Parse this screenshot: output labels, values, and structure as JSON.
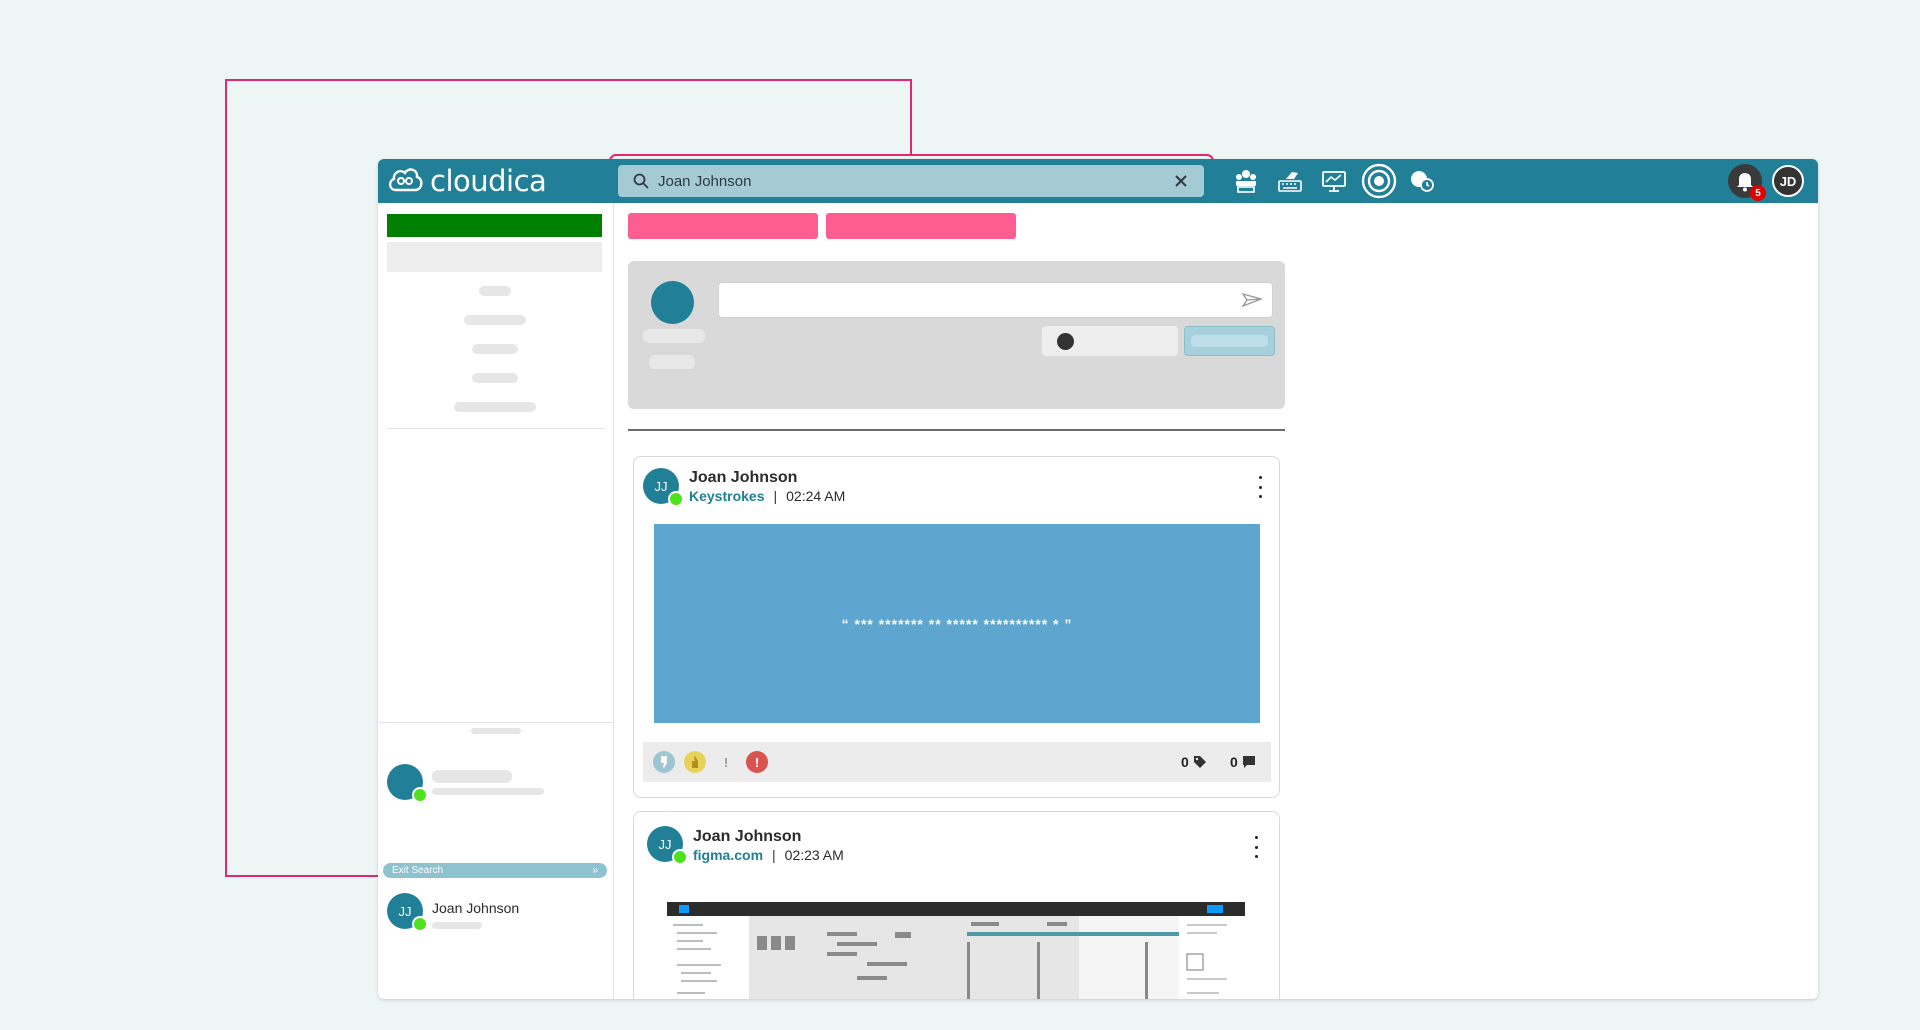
{
  "app": {
    "logo_text": "cloudica",
    "brand_color": "#217f97"
  },
  "search": {
    "value": "Joan Johnson",
    "icon": "search-icon",
    "clear_icon": "close-icon"
  },
  "toolbar": {
    "icons": [
      "people-desk-icon",
      "keyboard-hand-icon",
      "monitor-chart-icon",
      "radar-circle-icon",
      "person-clock-icon"
    ]
  },
  "notifications": {
    "count": "5"
  },
  "user": {
    "initials": "JD"
  },
  "sidebar": {
    "exit_search_label": "Exit Search",
    "exit_search_icon": "double-chevron-right-icon",
    "result": {
      "initials": "JJ",
      "name": "Joan Johnson"
    }
  },
  "posts": [
    {
      "initials": "JJ",
      "author": "Joan Johnson",
      "source": "Keystrokes",
      "time": "02:24 AM",
      "quote": "“ *** ******* ** ***** ********** * ”",
      "tag_count": "0",
      "comment_count": "0",
      "reactions": [
        "thumbs-down-icon",
        "thumbs-up-icon",
        "exclamation-icon",
        "alert-icon"
      ]
    },
    {
      "initials": "JJ",
      "author": "Joan Johnson",
      "source": "figma.com",
      "time": "02:23 AM"
    }
  ]
}
